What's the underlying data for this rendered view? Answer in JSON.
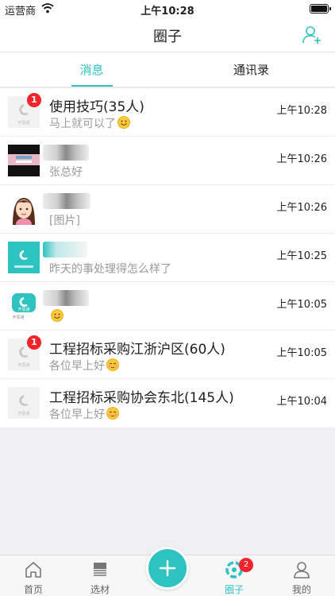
{
  "status_bar": {
    "carrier": "运营商",
    "time": "上午10:28",
    "wifi_icon": "wifi-icon",
    "battery_icon": "battery-icon"
  },
  "nav": {
    "title": "圈子",
    "add_friend_icon": "add-friend-icon"
  },
  "tabs": [
    {
      "label": "消息",
      "active": true
    },
    {
      "label": "通讯录",
      "active": false
    }
  ],
  "conversations": [
    {
      "title": "使用技巧(35人)",
      "message": "马上就可以了",
      "time": "上午10:28",
      "badge": "1",
      "avatar_label": "开思通"
    },
    {
      "title": "",
      "message": "张总好",
      "time": "上午10:26",
      "badge": ""
    },
    {
      "title": "",
      "message": "[图片]",
      "time": "上午10:26",
      "badge": ""
    },
    {
      "title": "",
      "message": "昨天的事处理得怎么样了",
      "time": "上午10:25",
      "badge": ""
    },
    {
      "title": "",
      "message": "",
      "time": "上午10:05",
      "badge": "",
      "avatar_label": "开思通",
      "avatar_caption": "开思通"
    },
    {
      "title": "工程招标采购江浙沪区(60人)",
      "message": "各位早上好",
      "time": "上午10:05",
      "badge": "1",
      "avatar_label": "开思通"
    },
    {
      "title": "工程招标采购协会东北(145人)",
      "message": "各位早上好",
      "time": "上午10:04",
      "badge": "",
      "avatar_label": "开思通"
    }
  ],
  "tab_bar": [
    {
      "label": "首页",
      "icon": "home-icon"
    },
    {
      "label": "选材",
      "icon": "materials-icon"
    },
    {
      "label": "",
      "icon": "plus-icon"
    },
    {
      "label": "圈子",
      "icon": "circle-icon",
      "badge": "2",
      "active": true
    },
    {
      "label": "我的",
      "icon": "profile-icon"
    }
  ],
  "colors": {
    "accent": "#2ec2c0",
    "badge": "#f0242a"
  }
}
